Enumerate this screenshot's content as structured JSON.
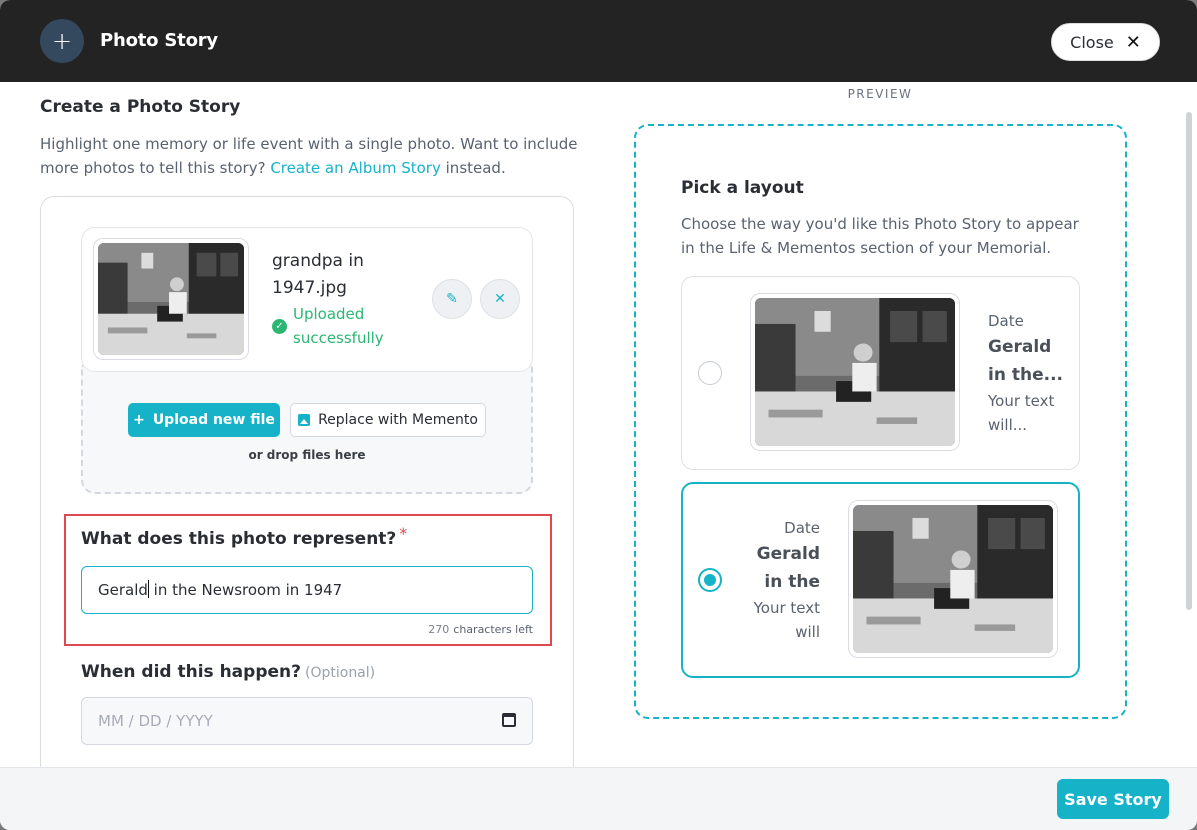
{
  "header": {
    "title": "Photo Story",
    "close_label": "Close"
  },
  "form": {
    "section_title": "Create a Photo Story",
    "intro_text": "Highlight one memory or life event with a single photo. Want to include more photos to tell this story?",
    "intro_link": "Create an Album Story",
    "intro_suffix": "instead.",
    "file": {
      "name": "grandpa in 1947.jpg",
      "status": "Uploaded successfully"
    },
    "upload_new_label": "Upload new file",
    "replace_label": "Replace with Memento",
    "drop_text": "or drop files here",
    "question_label": "What does this photo represent?",
    "required_mark": "*",
    "title_before_cursor": "Gerald",
    "title_after_cursor": " in the Newsroom in 1947",
    "chars_left_count": "270",
    "chars_left_label": "characters left",
    "when_label": "When did this happen?",
    "when_optional": "(Optional)",
    "date_placeholder": "MM / DD / YYYY"
  },
  "preview": {
    "label": "PREVIEW",
    "title": "Pick a layout",
    "description": "Choose the way you'd like this Photo Story to appear in the Life & Mementos section of your Memorial.",
    "layouts": [
      {
        "date": "Date",
        "title": "Gerald in the...",
        "text": "Your text will...",
        "selected": false
      },
      {
        "date": "Date",
        "title": "Gerald in the",
        "text": "Your text will",
        "selected": true
      }
    ]
  },
  "footer": {
    "save_label": "Save Story"
  },
  "colors": {
    "accent": "#16b3c8",
    "success": "#2bb673",
    "required": "#e0484f",
    "header_bg": "#232323"
  }
}
